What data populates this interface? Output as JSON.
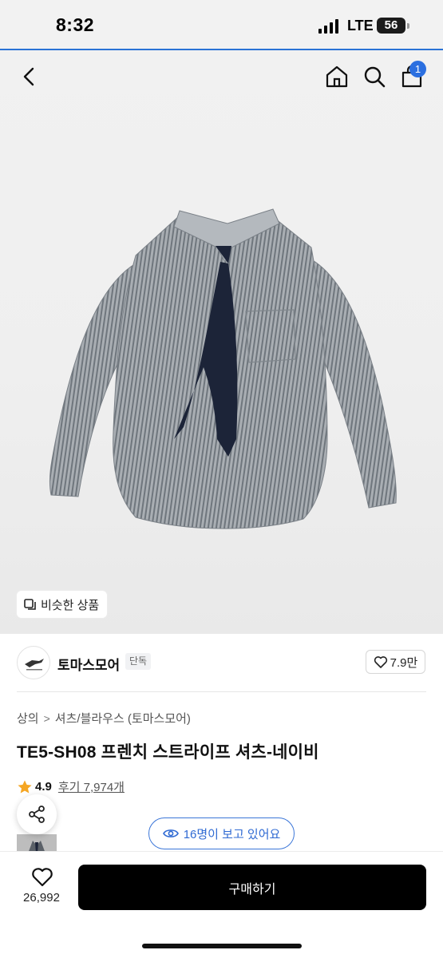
{
  "status_bar": {
    "time": "8:32",
    "network": "LTE",
    "battery": "56"
  },
  "nav": {
    "back_icon": "chevron-left-icon",
    "home_icon": "home-icon",
    "search_icon": "search-icon",
    "bag_icon": "shopping-bag-icon",
    "cart_badge": "1"
  },
  "hero": {
    "similar_products_label": "비슷한 상품"
  },
  "brand": {
    "name": "토마스모어",
    "tag": "단독",
    "likes": "7.9만"
  },
  "product": {
    "breadcrumb": [
      "상의",
      "셔츠/블라우스 (토마스모어)"
    ],
    "breadcrumb_separator": ">",
    "title": "TE5-SH08 프렌치 스트라이프 셔츠-네이비",
    "rating": "4.9",
    "review_link": "후기 7,974개",
    "viewers": "16명이 보고 있어요"
  },
  "bottom_bar": {
    "wish_count": "26,992",
    "buy_label": "구매하기"
  },
  "colors": {
    "accent_blue": "#2b6fe0",
    "star": "#f5a623",
    "buy_button": "#000000"
  }
}
